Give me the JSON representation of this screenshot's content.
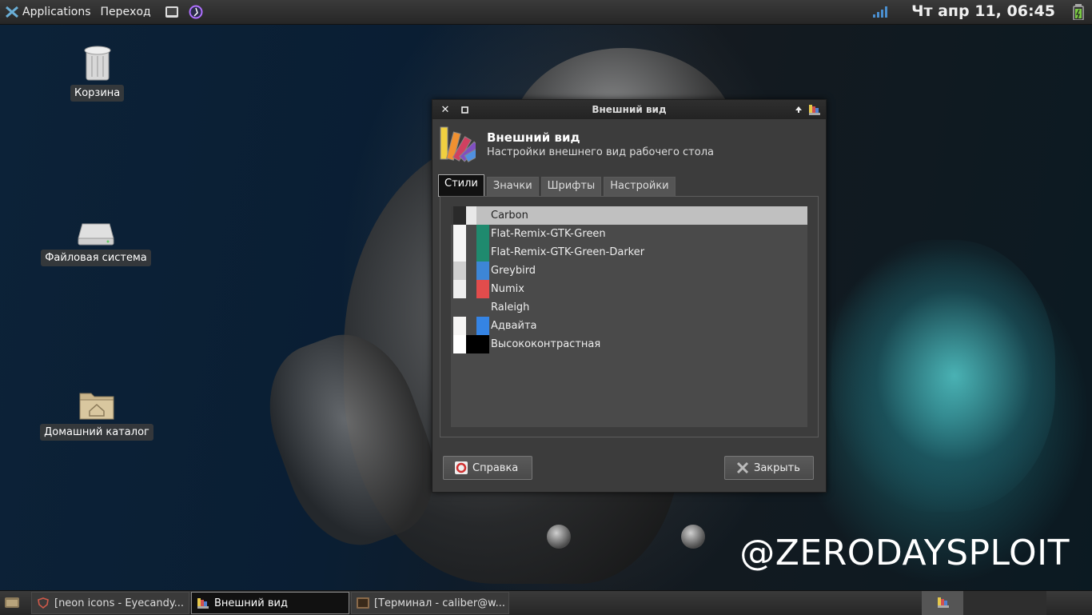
{
  "top_panel": {
    "applications_label": "Applications",
    "goto_label": "Переход",
    "clock": "Чт апр 11, 06:45"
  },
  "desktop": {
    "icons": [
      {
        "label": "Корзина",
        "icon": "trash-icon"
      },
      {
        "label": "Файловая система",
        "icon": "drive-icon"
      },
      {
        "label": "Домашний каталог",
        "icon": "home-folder-icon"
      }
    ],
    "watermark": "@ZERODAYSPLOIT"
  },
  "dialog": {
    "window_title": "Внешний вид",
    "header_title": "Внешний вид",
    "header_subtitle": "Настройки внешнего вид рабочего стола",
    "tabs": [
      {
        "label": "Стили",
        "active": true
      },
      {
        "label": "Значки",
        "active": false
      },
      {
        "label": "Шрифты",
        "active": false
      },
      {
        "label": "Настройки",
        "active": false
      }
    ],
    "themes": [
      {
        "name": "Carbon",
        "selected": true,
        "colors": [
          "#2a2a2a",
          "#e8e8e8",
          "#c0c0c0"
        ]
      },
      {
        "name": "Flat-Remix-GTK-Green",
        "selected": false,
        "colors": [
          "#f5f5f5",
          "#4a4a4a",
          "#1f8a6e"
        ]
      },
      {
        "name": "Flat-Remix-GTK-Green-Darker",
        "selected": false,
        "colors": [
          "#f5f5f5",
          "#4a4a4a",
          "#1f8a6e"
        ]
      },
      {
        "name": "Greybird",
        "selected": false,
        "colors": [
          "#cfcfcf",
          "#4a4a4a",
          "#3d86d6"
        ]
      },
      {
        "name": "Numix",
        "selected": false,
        "colors": [
          "#eeeeee",
          "#4a4a4a",
          "#e24c4c"
        ]
      },
      {
        "name": "Raleigh",
        "selected": false,
        "colors": [
          "#4a4a4a",
          "#4a4a4a",
          "#4a4a4a"
        ]
      },
      {
        "name": "Адвайта",
        "selected": false,
        "colors": [
          "#f6f5f4",
          "#4a4a4a",
          "#3584e4"
        ]
      },
      {
        "name": "Высококонтрастная",
        "selected": false,
        "colors": [
          "#ffffff",
          "#000000",
          "#000000"
        ]
      }
    ],
    "help_label": "Справка",
    "close_label": "Закрыть"
  },
  "taskbar": {
    "tasks": [
      {
        "label": "[neon icons - Eyecandy...",
        "active": false
      },
      {
        "label": "Внешний вид",
        "active": true
      },
      {
        "label": "[Терминал - caliber@w...",
        "active": false
      }
    ]
  }
}
